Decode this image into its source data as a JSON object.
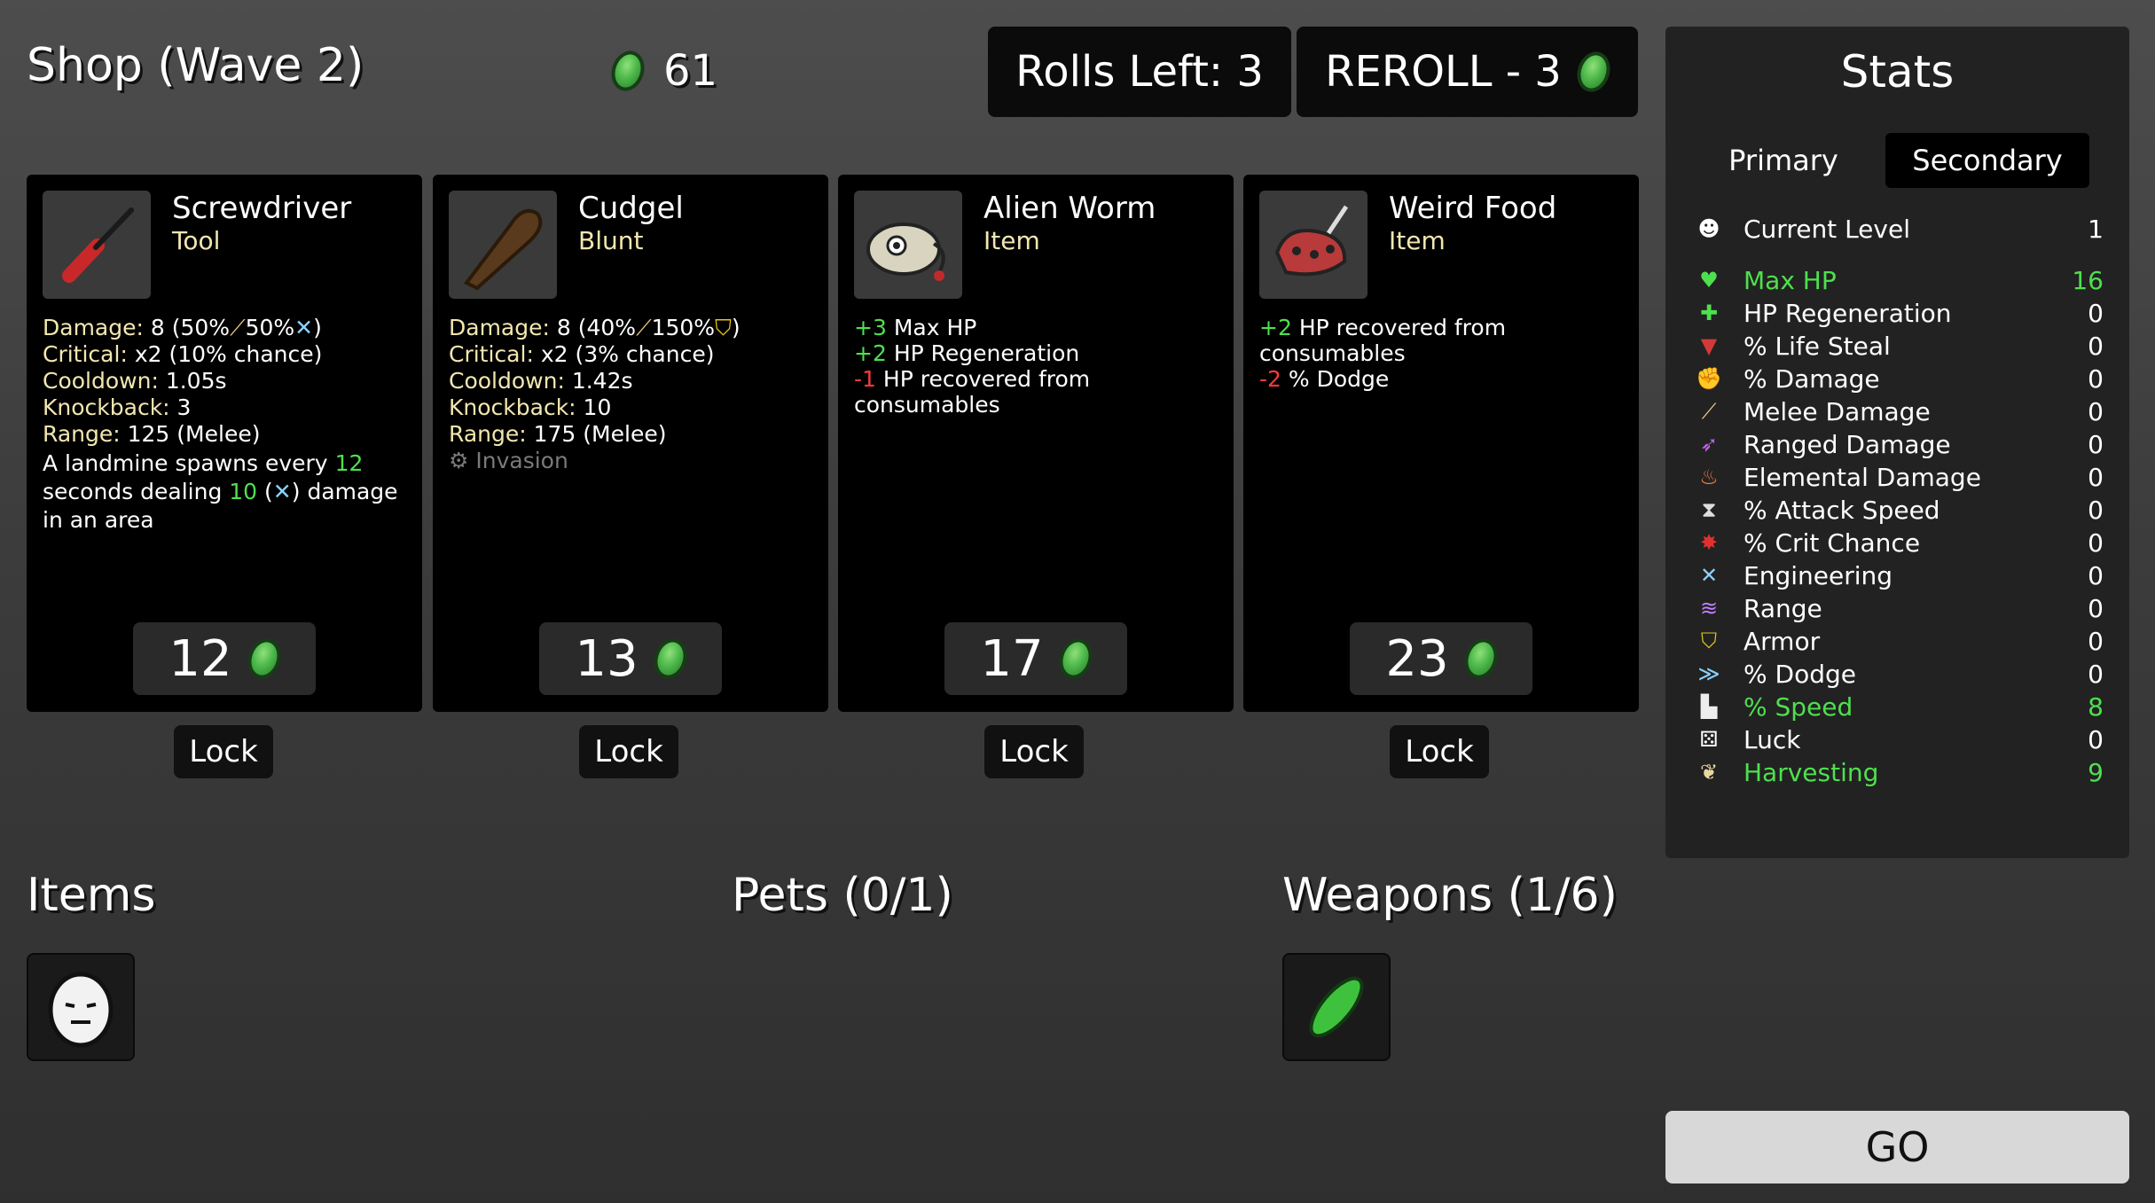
{
  "header": {
    "shop_title": "Shop (Wave 2)",
    "gold": "61",
    "rolls_left": "Rolls Left: 3",
    "reroll": "REROLL - 3"
  },
  "cards": [
    {
      "name": "Screwdriver",
      "type": "Tool",
      "price": "12",
      "lock": "Lock",
      "damage_label": "Damage:",
      "damage_val": "8 (50%",
      "damage_mid": "50%",
      "damage_end": ")",
      "critical_label": "Critical:",
      "critical_val": "x2 (10% chance)",
      "cooldown_label": "Cooldown:",
      "cooldown_val": "1.05s",
      "knockback_label": "Knockback:",
      "knockback_val": "3",
      "range_label": "Range:",
      "range_val": "125 (Melee)",
      "effect_1": "A landmine spawns every",
      "effect_num1": "12",
      "effect_2": "seconds dealing",
      "effect_num2": "10",
      "effect_3": "(",
      "effect_4": ") damage",
      "effect_5": "in an area"
    },
    {
      "name": "Cudgel",
      "type": "Blunt",
      "price": "13",
      "lock": "Lock",
      "damage_label": "Damage:",
      "damage_val": "8 (40%",
      "damage_mid": "150%",
      "damage_end": ")",
      "critical_label": "Critical:",
      "critical_val": "x2 (3% chance)",
      "cooldown_label": "Cooldown:",
      "cooldown_val": "1.42s",
      "knockback_label": "Knockback:",
      "knockback_val": "10",
      "range_label": "Range:",
      "range_val": "175 (Melee)",
      "set": "Invasion"
    },
    {
      "name": "Alien Worm",
      "type": "Item",
      "price": "17",
      "lock": "Lock",
      "l1_num": "+3",
      "l1_text": "Max HP",
      "l2_num": "+2",
      "l2_text": "HP Regeneration",
      "l3_num": "-1",
      "l3_text": "HP recovered from",
      "l4_text": "consumables"
    },
    {
      "name": "Weird Food",
      "type": "Item",
      "price": "23",
      "lock": "Lock",
      "l1_num": "+2",
      "l1_text": "HP recovered from",
      "l2_text": "consumables",
      "l3_num": "-2",
      "l3_text": "% Dodge"
    }
  ],
  "stats": {
    "title": "Stats",
    "tab_primary": "Primary",
    "tab_secondary": "Secondary",
    "rows": [
      {
        "name": "Current Level",
        "value": "1",
        "icon": "level-icon",
        "color": "#ffffff"
      },
      {
        "name": "Max HP",
        "value": "16",
        "icon": "heart-icon",
        "color": "#4ee04e"
      },
      {
        "name": "HP Regeneration",
        "value": "0",
        "icon": "regen-icon",
        "color": "#ffffff"
      },
      {
        "name": "% Life Steal",
        "value": "0",
        "icon": "life-steal-icon",
        "color": "#ffffff"
      },
      {
        "name": "% Damage",
        "value": "0",
        "icon": "damage-icon",
        "color": "#ffffff"
      },
      {
        "name": "Melee Damage",
        "value": "0",
        "icon": "sword-icon",
        "color": "#ffffff"
      },
      {
        "name": "Ranged Damage",
        "value": "0",
        "icon": "bow-icon",
        "color": "#ffffff"
      },
      {
        "name": "Elemental Damage",
        "value": "0",
        "icon": "fire-icon",
        "color": "#ffffff"
      },
      {
        "name": "% Attack Speed",
        "value": "0",
        "icon": "hourglass-icon",
        "color": "#ffffff"
      },
      {
        "name": "% Crit Chance",
        "value": "0",
        "icon": "crit-icon",
        "color": "#ffffff"
      },
      {
        "name": "Engineering",
        "value": "0",
        "icon": "wrench-icon",
        "color": "#ffffff"
      },
      {
        "name": "Range",
        "value": "0",
        "icon": "range-icon",
        "color": "#ffffff"
      },
      {
        "name": "Armor",
        "value": "0",
        "icon": "shield-icon",
        "color": "#ffffff"
      },
      {
        "name": "% Dodge",
        "value": "0",
        "icon": "dodge-icon",
        "color": "#ffffff"
      },
      {
        "name": "% Speed",
        "value": "8",
        "icon": "boot-icon",
        "color": "#4ee04e"
      },
      {
        "name": "Luck",
        "value": "0",
        "icon": "dice-icon",
        "color": "#ffffff"
      },
      {
        "name": "Harvesting",
        "value": "9",
        "icon": "wheat-icon",
        "color": "#4ee04e"
      }
    ]
  },
  "sections": {
    "items": "Items",
    "pets": "Pets (0/1)",
    "weapons": "Weapons (1/6)"
  },
  "go": "GO"
}
